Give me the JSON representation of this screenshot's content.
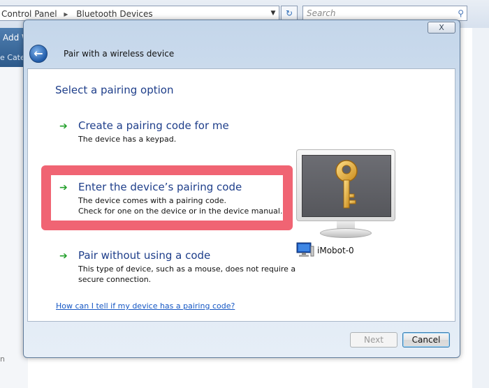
{
  "background_window": {
    "breadcrumb": [
      "Control Panel",
      "Bluetooth Devices"
    ],
    "search_placeholder": "Search",
    "toolbar_add": "Add W",
    "toolbar_category": "e Cate",
    "left_fragment": "n"
  },
  "dialog": {
    "title": "Pair with a wireless device",
    "close_label": "X",
    "heading": "Select a pairing option",
    "options": [
      {
        "title": "Create a pairing code for me",
        "desc_lines": [
          "The device has a keypad."
        ]
      },
      {
        "title": "Enter the device’s pairing code",
        "desc_lines": [
          "The device comes with a pairing code.",
          "Check for one on the device or in the device manual."
        ]
      },
      {
        "title": "Pair without using a code",
        "desc_lines": [
          "This type of device, such as a mouse, does not require a",
          "secure connection."
        ]
      }
    ],
    "help_link": "How can I tell if my device has a pairing code?",
    "device_name": "iMobot-0",
    "buttons": {
      "next": "Next",
      "cancel": "Cancel"
    },
    "selected_option_index": 1,
    "highlight_color": "#f06473",
    "accent_color": "#1e3e8a",
    "link_color": "#1557c4"
  }
}
